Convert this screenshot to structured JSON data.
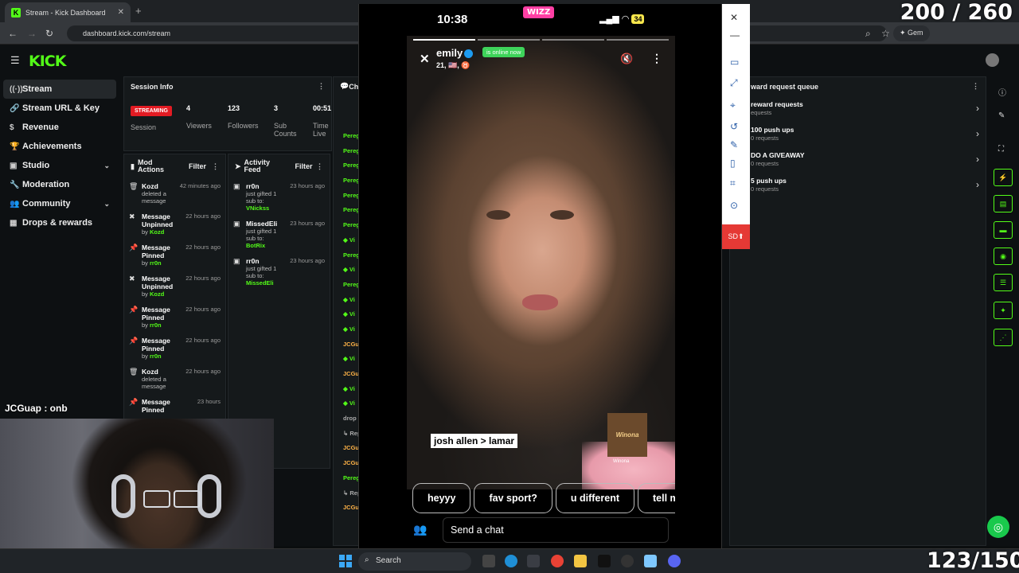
{
  "browser": {
    "tab_title": "Stream - Kick Dashboard",
    "tab_favicon": "K",
    "url": "dashboard.kick.com/stream",
    "gemini_label": "Gem"
  },
  "overlay": {
    "counter_top": "200 / 260",
    "counter_bottom": "123/150"
  },
  "kick": {
    "logo": "KICK",
    "nav": [
      {
        "label": "Stream",
        "icon": "((·))"
      },
      {
        "label": "Stream URL & Key",
        "icon": "🔗"
      },
      {
        "label": "Revenue",
        "icon": "$"
      },
      {
        "label": "Achievements",
        "icon": "🏆"
      },
      {
        "label": "Studio",
        "icon": "▣"
      },
      {
        "label": "Moderation",
        "icon": "🔧"
      },
      {
        "label": "Community",
        "icon": "👥"
      },
      {
        "label": "Drops & rewards",
        "icon": "▦"
      }
    ],
    "session": {
      "title": "Session Info",
      "status": "STREAMING",
      "status_label": "Session",
      "viewers": "4",
      "viewers_label": "Viewers",
      "followers": "123",
      "followers_label": "Followers",
      "subs": "3",
      "subs_label": "Sub Counts",
      "time": "00:51",
      "time_label": "Time Live"
    },
    "mod_actions": {
      "title": "Mod Actions",
      "filter": "Filter",
      "items": [
        {
          "title": "Kozd",
          "sub": "deleted a message",
          "by": "",
          "time": "42 minutes ago",
          "icon": "🗑"
        },
        {
          "title": "Message Unpinned",
          "sub": "by",
          "by": "Kozd",
          "time": "22 hours ago",
          "icon": "✖"
        },
        {
          "title": "Message Pinned",
          "sub": "by",
          "by": "rr0n",
          "time": "22 hours ago",
          "icon": "📌"
        },
        {
          "title": "Message Unpinned",
          "sub": "by",
          "by": "Kozd",
          "time": "22 hours ago",
          "icon": "✖"
        },
        {
          "title": "Message Pinned",
          "sub": "by",
          "by": "rr0n",
          "time": "22 hours ago",
          "icon": "📌"
        },
        {
          "title": "Message Pinned",
          "sub": "by",
          "by": "rr0n",
          "time": "22 hours ago",
          "icon": "📌"
        },
        {
          "title": "Kozd",
          "sub": "deleted a message",
          "by": "",
          "time": "22 hours ago",
          "icon": "🗑"
        },
        {
          "title": "Message Pinned",
          "sub": "",
          "by": "",
          "time": "23 hours",
          "icon": "📌"
        }
      ]
    },
    "activity": {
      "title": "Activity Feed",
      "filter": "Filter",
      "items": [
        {
          "user": "rr0n",
          "sub": "just gifted 1 sub to:",
          "target": "VNickss",
          "time": "23 hours ago"
        },
        {
          "user": "MissedEli",
          "sub": "just gifted 1 sub to:",
          "target": "BotRix",
          "time": "23 hours ago"
        },
        {
          "user": "rr0n",
          "sub": "just gifted 1 sub to:",
          "target": "MissedEli",
          "time": "23 hours ago"
        }
      ]
    },
    "chat": {
      "title": "Cha",
      "lines": [
        "Pereg",
        "Pereg",
        "Pereg",
        "Pereg",
        "Pereg",
        "Pereg",
        "Pereg",
        "◆ Vi",
        "Pereg",
        "◆ Vi",
        "Pereg",
        "◆ Vi",
        "◆ Vi",
        "◆ Vi",
        "JCGu",
        "◆ Vi",
        "JCGu",
        "◆ Vi",
        "◆ Vi",
        "drop",
        "↳ Rep",
        "JCGu",
        "JCGu",
        "Pereg",
        "↳ Rep",
        "JCGu"
      ]
    },
    "rewards": {
      "title": "ward request queue",
      "items": [
        {
          "label": "reward requests",
          "count": "equests"
        },
        {
          "label": "100 push ups",
          "count": "0 requests"
        },
        {
          "label": "DO A GIVEAWAY",
          "count": "0 requests"
        },
        {
          "label": "5 push ups",
          "count": "0 requests"
        }
      ]
    }
  },
  "phone": {
    "time": "10:38",
    "app": "WIZZ",
    "battery": "34",
    "name": "emily",
    "sub": "21, 🇺🇸, ♉",
    "online": "is online now",
    "caption": "josh allen > lamar",
    "sticker": "Winona",
    "sticker_sub": "Winona",
    "chips": [
      "heyyy",
      "fav sport?",
      "u different",
      "tell m"
    ],
    "send_placeholder": "Send a chat"
  },
  "webcam": {
    "label": "JCGuap : onb"
  },
  "taskbar": {
    "search": "Search"
  }
}
